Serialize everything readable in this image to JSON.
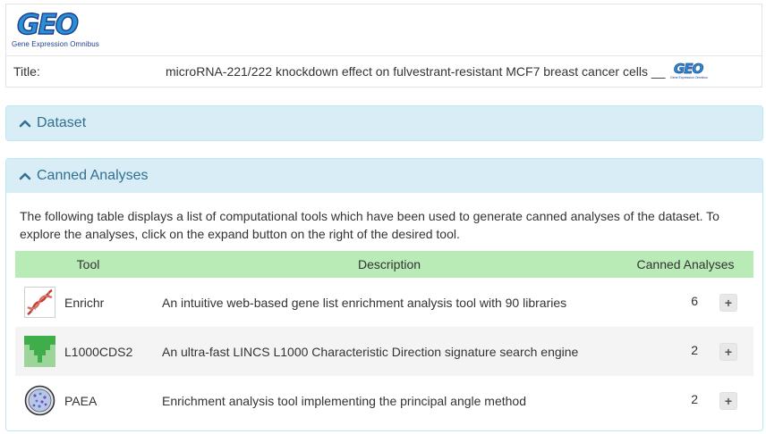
{
  "header": {
    "logo_text": "GEO",
    "logo_subtitle": "Gene Expression Omnibus",
    "title_label": "Title:",
    "title_value": "microRNA-221/222 knockdown effect on fulvestrant-resistant MCF7 breast cancer cells",
    "title_separator": "__",
    "mini_logo_text": "GEO",
    "mini_logo_subtitle": "Gene Expression Omnibus"
  },
  "panels": {
    "dataset": {
      "label": "Dataset",
      "icon": "chevron-up-icon"
    },
    "canned": {
      "label": "Canned Analyses",
      "icon": "chevron-up-icon",
      "intro": "The following table displays a list of computational tools which have been used to generate canned analyses of the dataset. To explore the analyses, click on the expand button on the right of the desired tool."
    }
  },
  "table": {
    "headers": [
      "Tool",
      "Description",
      "Canned Analyses"
    ],
    "rows": [
      {
        "tool": "Enrichr",
        "icon": "dna-helix-icon",
        "description": "An intuitive web-based gene list enrichment analysis tool with 90 libraries",
        "count": "6",
        "action": "+"
      },
      {
        "tool": "L1000CDS2",
        "icon": "green-funnel-icon",
        "description": "An ultra-fast LINCS L1000 Characteristic Direction signature search engine",
        "count": "2",
        "action": "+"
      },
      {
        "tool": "PAEA",
        "icon": "petri-dish-icon",
        "description": "Enrichment analysis tool implementing the principal angle method",
        "count": "2",
        "action": "+"
      }
    ]
  },
  "colors": {
    "panel_heading_bg": "#d9edf7",
    "panel_heading_text": "#31708f",
    "table_header_bg": "#b8ebb5",
    "logo_blue": "#2b8fd3",
    "logo_dark": "#1b3f8f"
  }
}
